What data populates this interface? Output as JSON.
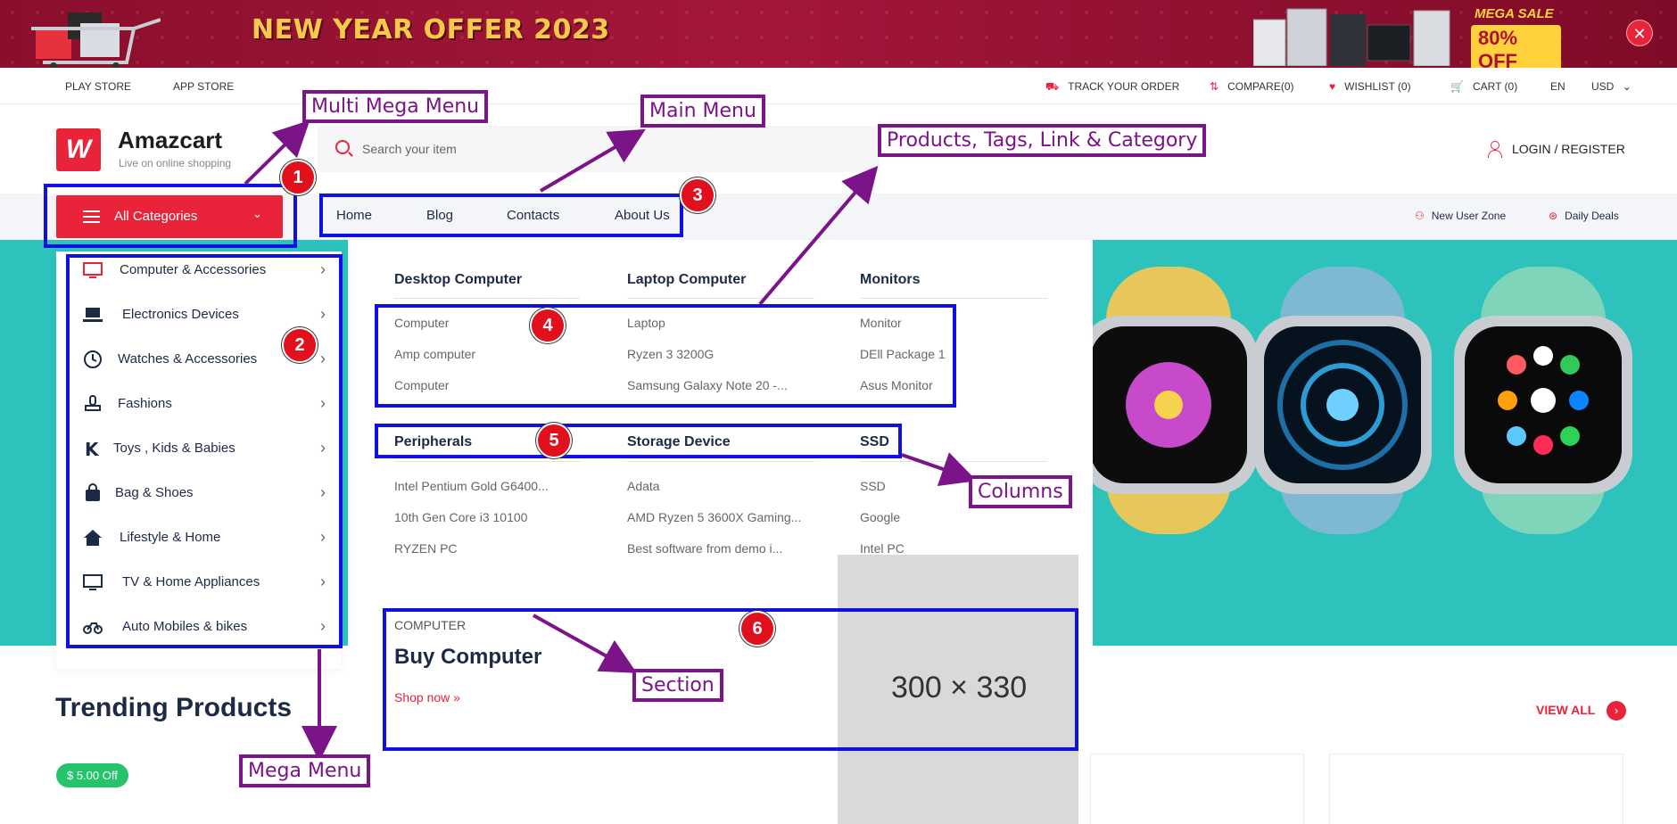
{
  "promo": {
    "title": "NEW YEAR OFFER 2023",
    "badge_line1": "MEGA SALE",
    "badge_line2": "80% OFF",
    "close_icon": "close-icon"
  },
  "topbar": {
    "left_links": [
      "PLAY STORE",
      "APP STORE"
    ],
    "track": "TRACK YOUR ORDER",
    "compare": "COMPARE(0)",
    "wishlist": "WISHLIST (0)",
    "cart": "CART (0)",
    "language": "EN",
    "currency": "USD"
  },
  "header": {
    "brand": "Amazcart",
    "tagline": "Live on online shopping",
    "search_placeholder": "Search your item",
    "login": "LOGIN / REGISTER"
  },
  "nav": {
    "all_categories": "All Categories",
    "main": [
      "Home",
      "Blog",
      "Contacts",
      "About Us"
    ],
    "new_user_zone": "New User Zone",
    "daily_deals": "Daily Deals"
  },
  "categories": [
    {
      "label": "Computer & Accessories",
      "icon": "monitor-icon"
    },
    {
      "label": "Electronics Devices",
      "icon": "laptop-icon"
    },
    {
      "label": "Watches & Accessories",
      "icon": "clock-icon"
    },
    {
      "label": "Fashions",
      "icon": "stamp-icon"
    },
    {
      "label": "Toys , Kids & Babies",
      "icon": "k-icon"
    },
    {
      "label": "Bag & Shoes",
      "icon": "bag-icon"
    },
    {
      "label": "Lifestyle & Home",
      "icon": "home-icon"
    },
    {
      "label": "TV & Home Appliances",
      "icon": "tv-icon"
    },
    {
      "label": "Auto Mobiles & bikes",
      "icon": "bike-icon"
    }
  ],
  "mega": {
    "columns_row1": [
      {
        "heading": "Desktop Computer",
        "items": [
          "Computer",
          "Amp computer",
          "Computer"
        ]
      },
      {
        "heading": "Laptop Computer",
        "items": [
          "Laptop",
          "Ryzen 3 3200G",
          "Samsung Galaxy Note 20 -..."
        ]
      },
      {
        "heading": "Monitors",
        "items": [
          "Monitor",
          "DEll Package 1",
          "Asus Monitor"
        ]
      }
    ],
    "columns_row2": [
      {
        "heading": "Peripherals",
        "items": [
          "Intel Pentium Gold G6400...",
          "10th Gen Core i3 10100",
          "RYZEN PC"
        ]
      },
      {
        "heading": "Storage Device",
        "items": [
          "Adata",
          "AMD Ryzen 5 3600X Gaming...",
          "Best software from demo i..."
        ]
      },
      {
        "heading": "SSD",
        "items": [
          "SSD",
          "Google",
          "Intel PC"
        ]
      }
    ],
    "section": {
      "eyebrow": "COMPUTER",
      "title": "Buy Computer",
      "link": "Shop now »"
    },
    "placeholder": "300 × 330"
  },
  "trending": {
    "title": "Trending Products",
    "view_all": "VIEW ALL",
    "badge": "$ 5.00 Off"
  },
  "annotations": {
    "labels": {
      "multi_mega_menu": "Multi Mega Menu",
      "main_menu": "Main Menu",
      "products_tags": "Products, Tags, Link & Category",
      "columns": "Columns",
      "section": "Section",
      "mega_menu": "Mega Menu"
    },
    "numbers": [
      "1",
      "2",
      "3",
      "4",
      "5",
      "6"
    ]
  },
  "colors": {
    "accent": "#e8233a",
    "annotation_box": "#1010e0",
    "annotation_label": "#7a1488",
    "hero": "#2dc3bc",
    "navy": "#1c2a45"
  }
}
